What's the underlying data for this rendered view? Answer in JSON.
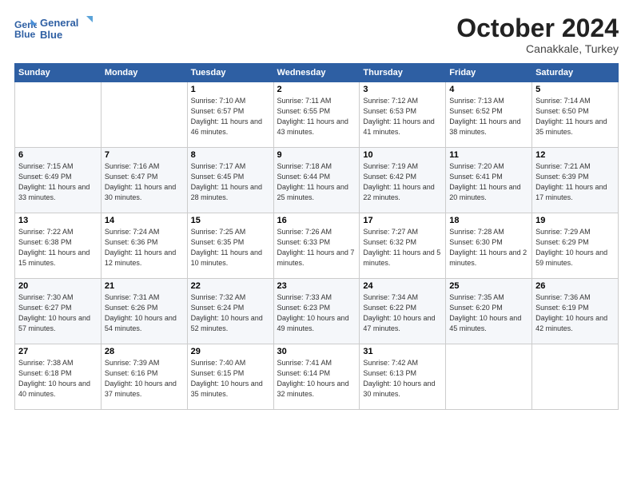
{
  "logo": {
    "line1": "General",
    "line2": "Blue"
  },
  "title": "October 2024",
  "location": "Canakkale, Turkey",
  "weekdays": [
    "Sunday",
    "Monday",
    "Tuesday",
    "Wednesday",
    "Thursday",
    "Friday",
    "Saturday"
  ],
  "weeks": [
    [
      {
        "day": "",
        "info": ""
      },
      {
        "day": "",
        "info": ""
      },
      {
        "day": "1",
        "info": "Sunrise: 7:10 AM\nSunset: 6:57 PM\nDaylight: 11 hours and 46 minutes."
      },
      {
        "day": "2",
        "info": "Sunrise: 7:11 AM\nSunset: 6:55 PM\nDaylight: 11 hours and 43 minutes."
      },
      {
        "day": "3",
        "info": "Sunrise: 7:12 AM\nSunset: 6:53 PM\nDaylight: 11 hours and 41 minutes."
      },
      {
        "day": "4",
        "info": "Sunrise: 7:13 AM\nSunset: 6:52 PM\nDaylight: 11 hours and 38 minutes."
      },
      {
        "day": "5",
        "info": "Sunrise: 7:14 AM\nSunset: 6:50 PM\nDaylight: 11 hours and 35 minutes."
      }
    ],
    [
      {
        "day": "6",
        "info": "Sunrise: 7:15 AM\nSunset: 6:49 PM\nDaylight: 11 hours and 33 minutes."
      },
      {
        "day": "7",
        "info": "Sunrise: 7:16 AM\nSunset: 6:47 PM\nDaylight: 11 hours and 30 minutes."
      },
      {
        "day": "8",
        "info": "Sunrise: 7:17 AM\nSunset: 6:45 PM\nDaylight: 11 hours and 28 minutes."
      },
      {
        "day": "9",
        "info": "Sunrise: 7:18 AM\nSunset: 6:44 PM\nDaylight: 11 hours and 25 minutes."
      },
      {
        "day": "10",
        "info": "Sunrise: 7:19 AM\nSunset: 6:42 PM\nDaylight: 11 hours and 22 minutes."
      },
      {
        "day": "11",
        "info": "Sunrise: 7:20 AM\nSunset: 6:41 PM\nDaylight: 11 hours and 20 minutes."
      },
      {
        "day": "12",
        "info": "Sunrise: 7:21 AM\nSunset: 6:39 PM\nDaylight: 11 hours and 17 minutes."
      }
    ],
    [
      {
        "day": "13",
        "info": "Sunrise: 7:22 AM\nSunset: 6:38 PM\nDaylight: 11 hours and 15 minutes."
      },
      {
        "day": "14",
        "info": "Sunrise: 7:24 AM\nSunset: 6:36 PM\nDaylight: 11 hours and 12 minutes."
      },
      {
        "day": "15",
        "info": "Sunrise: 7:25 AM\nSunset: 6:35 PM\nDaylight: 11 hours and 10 minutes."
      },
      {
        "day": "16",
        "info": "Sunrise: 7:26 AM\nSunset: 6:33 PM\nDaylight: 11 hours and 7 minutes."
      },
      {
        "day": "17",
        "info": "Sunrise: 7:27 AM\nSunset: 6:32 PM\nDaylight: 11 hours and 5 minutes."
      },
      {
        "day": "18",
        "info": "Sunrise: 7:28 AM\nSunset: 6:30 PM\nDaylight: 11 hours and 2 minutes."
      },
      {
        "day": "19",
        "info": "Sunrise: 7:29 AM\nSunset: 6:29 PM\nDaylight: 10 hours and 59 minutes."
      }
    ],
    [
      {
        "day": "20",
        "info": "Sunrise: 7:30 AM\nSunset: 6:27 PM\nDaylight: 10 hours and 57 minutes."
      },
      {
        "day": "21",
        "info": "Sunrise: 7:31 AM\nSunset: 6:26 PM\nDaylight: 10 hours and 54 minutes."
      },
      {
        "day": "22",
        "info": "Sunrise: 7:32 AM\nSunset: 6:24 PM\nDaylight: 10 hours and 52 minutes."
      },
      {
        "day": "23",
        "info": "Sunrise: 7:33 AM\nSunset: 6:23 PM\nDaylight: 10 hours and 49 minutes."
      },
      {
        "day": "24",
        "info": "Sunrise: 7:34 AM\nSunset: 6:22 PM\nDaylight: 10 hours and 47 minutes."
      },
      {
        "day": "25",
        "info": "Sunrise: 7:35 AM\nSunset: 6:20 PM\nDaylight: 10 hours and 45 minutes."
      },
      {
        "day": "26",
        "info": "Sunrise: 7:36 AM\nSunset: 6:19 PM\nDaylight: 10 hours and 42 minutes."
      }
    ],
    [
      {
        "day": "27",
        "info": "Sunrise: 7:38 AM\nSunset: 6:18 PM\nDaylight: 10 hours and 40 minutes."
      },
      {
        "day": "28",
        "info": "Sunrise: 7:39 AM\nSunset: 6:16 PM\nDaylight: 10 hours and 37 minutes."
      },
      {
        "day": "29",
        "info": "Sunrise: 7:40 AM\nSunset: 6:15 PM\nDaylight: 10 hours and 35 minutes."
      },
      {
        "day": "30",
        "info": "Sunrise: 7:41 AM\nSunset: 6:14 PM\nDaylight: 10 hours and 32 minutes."
      },
      {
        "day": "31",
        "info": "Sunrise: 7:42 AM\nSunset: 6:13 PM\nDaylight: 10 hours and 30 minutes."
      },
      {
        "day": "",
        "info": ""
      },
      {
        "day": "",
        "info": ""
      }
    ]
  ]
}
